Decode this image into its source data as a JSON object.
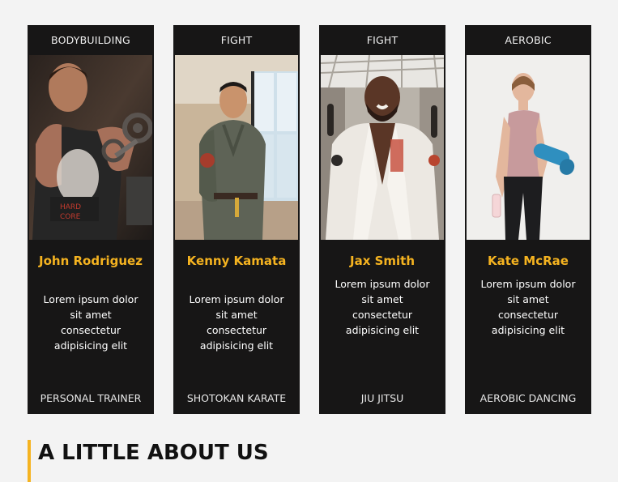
{
  "trainers": [
    {
      "category": "BODYBUILDING",
      "name": "John Rodriguez",
      "description": "Lorem ipsum dolor sit amet consectetur adipisicing elit",
      "specialty": "PERSONAL TRAINER"
    },
    {
      "category": "FIGHT",
      "name": "Kenny Kamata",
      "description": "Lorem ipsum dolor sit amet consectetur adipisicing elit",
      "specialty": "SHOTOKAN KARATE"
    },
    {
      "category": "FIGHT",
      "name": "Jax Smith",
      "description": "Lorem ipsum dolor sit amet consectetur adipisicing elit",
      "specialty": "JIU JITSU"
    },
    {
      "category": "AEROBIC",
      "name": "Kate McRae",
      "description": "Lorem ipsum dolor sit amet consectetur adipisicing elit",
      "specialty": "AEROBIC DANCING"
    }
  ],
  "about": {
    "heading": "A LITTLE ABOUT US"
  },
  "colors": {
    "accent": "#f5b320",
    "card_bg": "#171616",
    "page_bg": "#f3f3f3"
  }
}
